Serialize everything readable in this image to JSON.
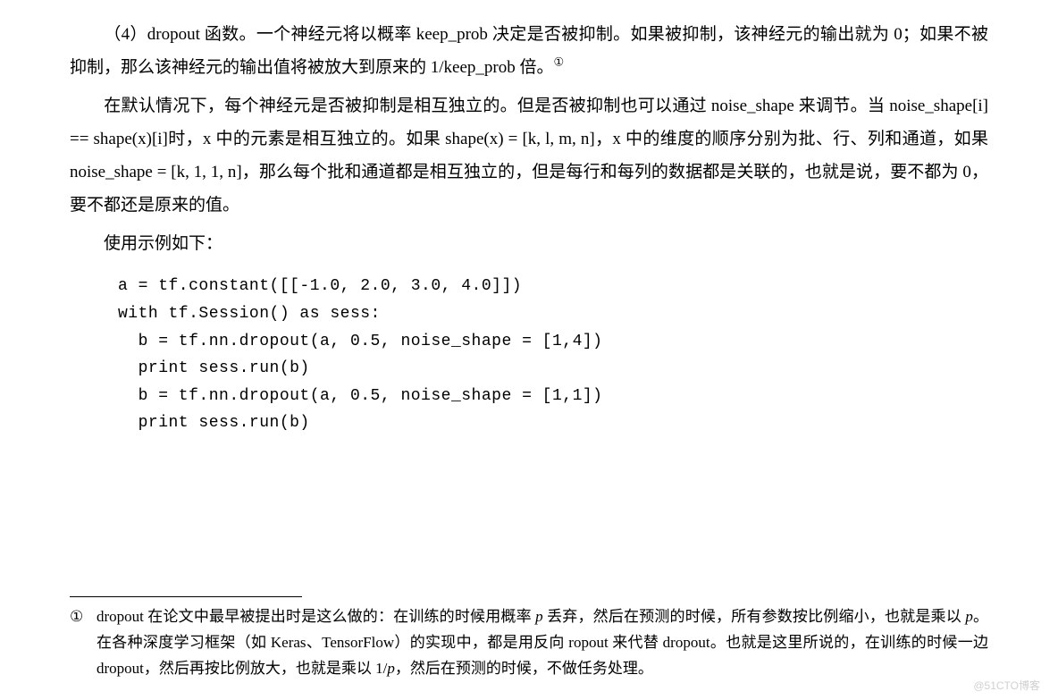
{
  "para1": "（4）dropout 函数。一个神经元将以概率 keep_prob 决定是否被抑制。如果被抑制，该神经元的输出就为 0；如果不被抑制，那么该神经元的输出值将被放大到原来的 1/keep_prob 倍。",
  "footnote_mark": "①",
  "para2": "在默认情况下，每个神经元是否被抑制是相互独立的。但是否被抑制也可以通过 noise_shape 来调节。当 noise_shape[i] == shape(x)[i]时，x 中的元素是相互独立的。如果 shape(x) = [k, l, m, n]，x 中的维度的顺序分别为批、行、列和通道，如果 noise_shape = [k, 1, 1, n]，那么每个批和通道都是相互独立的，但是每行和每列的数据都是关联的，也就是说，要不都为 0，要不都还是原来的值。",
  "para3": "使用示例如下：",
  "code": "a = tf.constant([[-1.0, 2.0, 3.0, 4.0]])\nwith tf.Session() as sess:\n  b = tf.nn.dropout(a, 0.5, noise_shape = [1,4])\n  print sess.run(b)\n  b = tf.nn.dropout(a, 0.5, noise_shape = [1,1])\n  print sess.run(b)",
  "footnote_num": "①",
  "footnote_text_pre": "dropout 在论文中最早被提出时是这么做的：在训练的时候用概率 ",
  "footnote_p1": "p",
  "footnote_text_mid1": " 丢弃，然后在预测的时候，所有参数按比例缩小，也就是乘以 ",
  "footnote_p2": "p",
  "footnote_text_mid2": "。在各种深度学习框架（如 Keras、TensorFlow）的实现中，都是用反向 ropout 来代替 dropout。也就是这里所说的，在训练的时候一边 dropout，然后再按比例放大，也就是乘以 1/",
  "footnote_p3": "p",
  "footnote_text_post": "，然后在预测的时候，不做任务处理。",
  "watermark": "@51CTO博客"
}
